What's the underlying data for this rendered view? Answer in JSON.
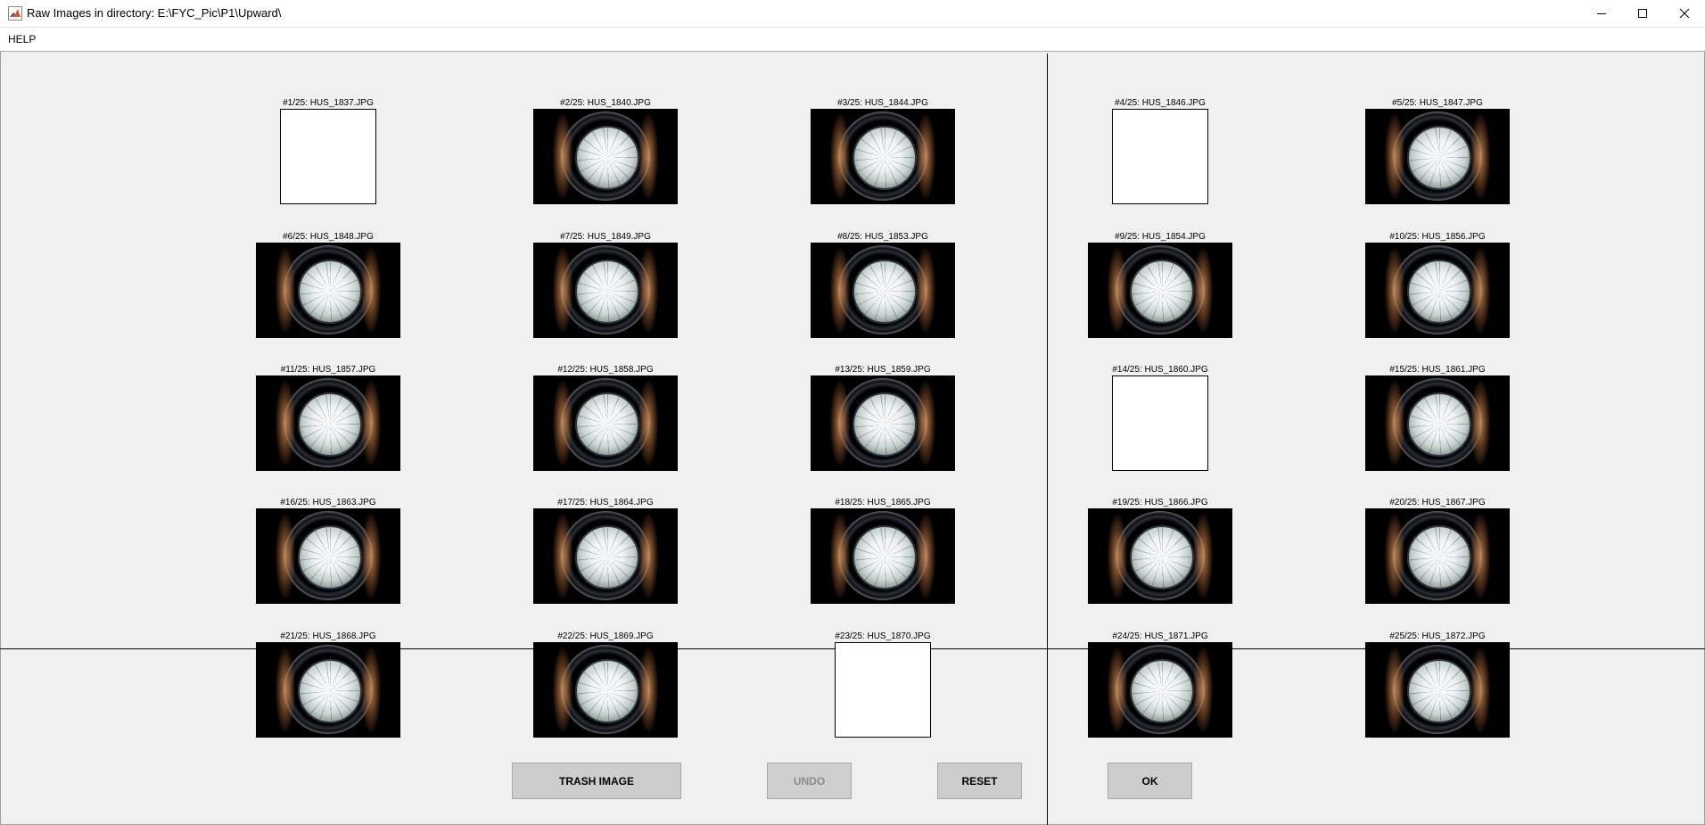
{
  "window": {
    "title": "Raw Images in directory: E:\\FYC_Pic\\P1\\Upward\\",
    "app_icon": "matlab-icon",
    "controls": [
      "minimize-icon",
      "maximize-icon",
      "close-icon"
    ]
  },
  "menu": {
    "help": "HELP"
  },
  "images": [
    {
      "label": "#1/25: HUS_1837.JPG",
      "blank": true
    },
    {
      "label": "#2/25: HUS_1840.JPG",
      "blank": false
    },
    {
      "label": "#3/25: HUS_1844.JPG",
      "blank": false
    },
    {
      "label": "#4/25: HUS_1846.JPG",
      "blank": true
    },
    {
      "label": "#5/25: HUS_1847.JPG",
      "blank": false
    },
    {
      "label": "#6/25: HUS_1848.JPG",
      "blank": false
    },
    {
      "label": "#7/25: HUS_1849.JPG",
      "blank": false
    },
    {
      "label": "#8/25: HUS_1853.JPG",
      "blank": false
    },
    {
      "label": "#9/25: HUS_1854.JPG",
      "blank": false
    },
    {
      "label": "#10/25: HUS_1856.JPG",
      "blank": false
    },
    {
      "label": "#11/25: HUS_1857.JPG",
      "blank": false
    },
    {
      "label": "#12/25: HUS_1858.JPG",
      "blank": false
    },
    {
      "label": "#13/25: HUS_1859.JPG",
      "blank": false
    },
    {
      "label": "#14/25: HUS_1860.JPG",
      "blank": true
    },
    {
      "label": "#15/25: HUS_1861.JPG",
      "blank": false
    },
    {
      "label": "#16/25: HUS_1863.JPG",
      "blank": false
    },
    {
      "label": "#17/25: HUS_1864.JPG",
      "blank": false
    },
    {
      "label": "#18/25: HUS_1865.JPG",
      "blank": false
    },
    {
      "label": "#19/25: HUS_1866.JPG",
      "blank": false
    },
    {
      "label": "#20/25: HUS_1867.JPG",
      "blank": false
    },
    {
      "label": "#21/25: HUS_1868.JPG",
      "blank": false
    },
    {
      "label": "#22/25: HUS_1869.JPG",
      "blank": false
    },
    {
      "label": "#23/25: HUS_1870.JPG",
      "blank": true
    },
    {
      "label": "#24/25: HUS_1871.JPG",
      "blank": false
    },
    {
      "label": "#25/25: HUS_1872.JPG",
      "blank": false
    }
  ],
  "buttons": {
    "trash": "TRASH IMAGE",
    "undo": "UNDO",
    "undo_enabled": false,
    "reset": "RESET",
    "ok": "OK"
  }
}
